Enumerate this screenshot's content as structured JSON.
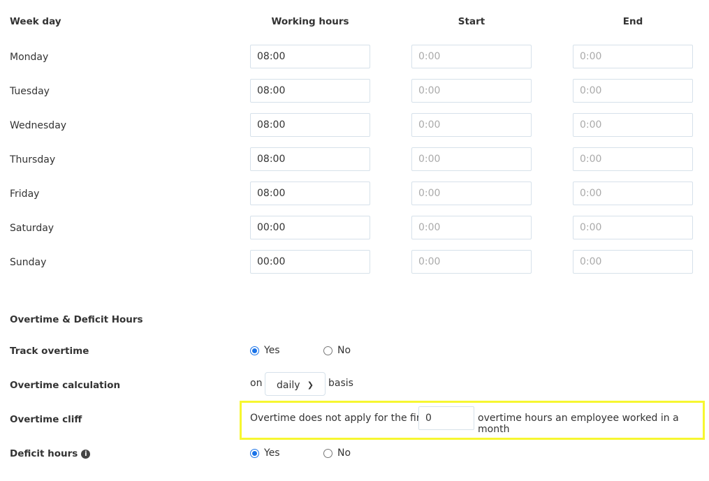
{
  "headers": {
    "week_day": "Week day",
    "working_hours": "Working hours",
    "start": "Start",
    "end": "End"
  },
  "days": [
    {
      "name": "Monday",
      "hours": "08:00",
      "start_placeholder": "0:00",
      "end_placeholder": "0:00"
    },
    {
      "name": "Tuesday",
      "hours": "08:00",
      "start_placeholder": "0:00",
      "end_placeholder": "0:00"
    },
    {
      "name": "Wednesday",
      "hours": "08:00",
      "start_placeholder": "0:00",
      "end_placeholder": "0:00"
    },
    {
      "name": "Thursday",
      "hours": "08:00",
      "start_placeholder": "0:00",
      "end_placeholder": "0:00"
    },
    {
      "name": "Friday",
      "hours": "08:00",
      "start_placeholder": "0:00",
      "end_placeholder": "0:00"
    },
    {
      "name": "Saturday",
      "hours": "00:00",
      "start_placeholder": "0:00",
      "end_placeholder": "0:00"
    },
    {
      "name": "Sunday",
      "hours": "00:00",
      "start_placeholder": "0:00",
      "end_placeholder": "0:00"
    }
  ],
  "overtime": {
    "section_title": "Overtime & Deficit Hours",
    "track_label": "Track overtime",
    "track_value": "Yes",
    "calc_label": "Overtime calculation",
    "calc_prefix": "on",
    "calc_value": "daily",
    "calc_suffix": "basis",
    "cliff_label": "Overtime cliff",
    "cliff_prefix": "Overtime does not apply for the first",
    "cliff_value": "0",
    "cliff_suffix": "overtime hours an employee worked in a month",
    "deficit_label": "Deficit hours",
    "deficit_value": "Yes",
    "yes": "Yes",
    "no": "No",
    "accent": "#1a73e8",
    "highlight": "#f7f730"
  }
}
